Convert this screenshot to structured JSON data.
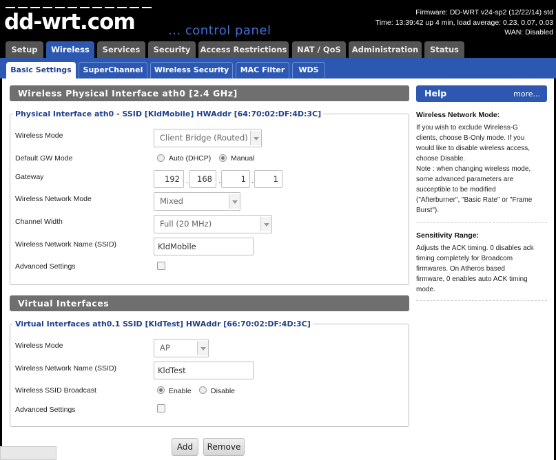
{
  "header": {
    "logo": "dd-wrt.com",
    "tagline": "... control panel",
    "firmware": "Firmware: DD-WRT v24-sp2 (12/22/14) std",
    "time": "Time: 13:39:42 up 4 min, load average: 0.23, 0.07, 0.03",
    "wan": "WAN: Disabled"
  },
  "main_tabs": [
    {
      "label": "Setup"
    },
    {
      "label": "Wireless"
    },
    {
      "label": "Services"
    },
    {
      "label": "Security"
    },
    {
      "label": "Access Restrictions"
    },
    {
      "label": "NAT / QoS"
    },
    {
      "label": "Administration"
    },
    {
      "label": "Status"
    }
  ],
  "sub_tabs": [
    {
      "label": "Basic Settings"
    },
    {
      "label": "SuperChannel"
    },
    {
      "label": "Wireless Security"
    },
    {
      "label": "MAC Filter"
    },
    {
      "label": "WDS"
    }
  ],
  "physical": {
    "section_title": "Wireless Physical Interface ath0 [2.4 GHz]",
    "legend": "Physical Interface ath0 - SSID [KldMobile] HWAddr [64:70:02:DF:4D:3C]",
    "wireless_mode_label": "Wireless Mode",
    "wireless_mode_value": "Client Bridge (Routed)",
    "gw_mode_label": "Default GW Mode",
    "gw_auto": "Auto (DHCP)",
    "gw_manual": "Manual",
    "gateway_label": "Gateway",
    "gateway": [
      "192",
      "168",
      "1",
      "1"
    ],
    "net_mode_label": "Wireless Network Mode",
    "net_mode_value": "Mixed",
    "channel_width_label": "Channel Width",
    "channel_width_value": "Full (20 MHz)",
    "ssid_label": "Wireless Network Name (SSID)",
    "ssid_value": "KldMobile",
    "advanced_label": "Advanced Settings"
  },
  "virtual": {
    "section_title": "Virtual Interfaces",
    "legend": "Virtual Interfaces ath0.1 SSID [KldTest] HWAddr [66:70:02:DF:4D:3C]",
    "wireless_mode_label": "Wireless Mode",
    "wireless_mode_value": "AP",
    "ssid_label": "Wireless Network Name (SSID)",
    "ssid_value": "KldTest",
    "broadcast_label": "Wireless SSID Broadcast",
    "broadcast_enable": "Enable",
    "broadcast_disable": "Disable",
    "advanced_label": "Advanced Settings"
  },
  "buttons": {
    "add": "Add",
    "remove": "Remove"
  },
  "help": {
    "title": "Help",
    "more": "more...",
    "mode_heading": "Wireless Network Mode:",
    "mode_lines": [
      "If you wish to exclude Wireless-G",
      "clients, choose B-Only mode. If you",
      "would like to disable wireless access,",
      "choose Disable.",
      "Note : when changing wireless mode,",
      "some advanced parameters are",
      "succeptible to be modified",
      "(\"Afterburner\", \"Basic Rate\" or \"Frame",
      "Burst\")."
    ],
    "sens_heading": "Sensitivity Range:",
    "sens_lines": [
      "Adjusts the ACK timing. 0 disables ack",
      "timing completely for Broadcom",
      "firmwares. On Atheros based",
      "firmware, 0 enables auto ACK timing",
      "mode."
    ]
  }
}
